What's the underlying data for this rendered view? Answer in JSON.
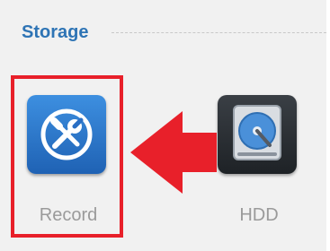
{
  "section": {
    "title": "Storage"
  },
  "tiles": [
    {
      "label": "Record",
      "icon": "record-settings-icon"
    },
    {
      "label": "HDD",
      "icon": "hdd-icon"
    }
  ],
  "colors": {
    "highlight": "#e8202a",
    "arrow": "#e8202a",
    "title": "#2e74b5"
  }
}
